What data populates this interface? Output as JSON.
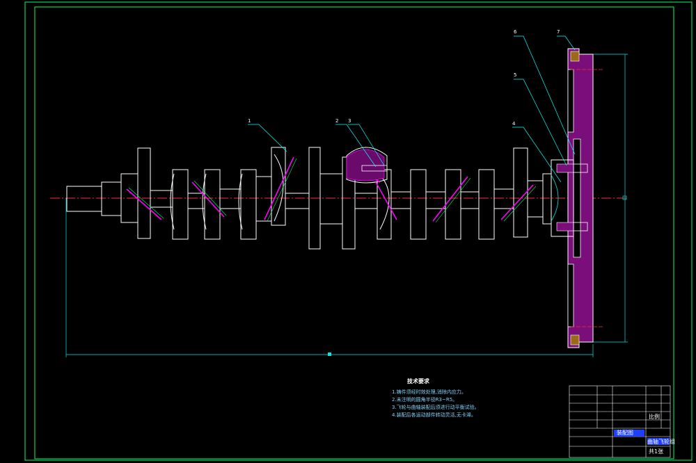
{
  "drawing": {
    "colors": {
      "background": "#000000",
      "frame": "#00ff66",
      "outline": "#ffffff",
      "dimension": "#00e5e5",
      "centerline": "#ff3030",
      "hatch": "#ff00ff",
      "leader": "#00ffff"
    },
    "callouts": [
      "1",
      "2",
      "3",
      "4",
      "5",
      "6",
      "7"
    ],
    "tech_notes": {
      "title": "技术要求",
      "lines": [
        "1.铸件须经时效处理,消除内应力。",
        "2.未注明的圆角半径R3~R5。",
        "3.飞轮与曲轴装配后须进行动平衡试验。",
        "4.装配后各运动部件转动灵活,无卡滞。"
      ]
    },
    "title_block": {
      "drawing_name": "曲轴飞轮组",
      "school": "装配图",
      "scale_label": "比例",
      "sheet_label": "共1张"
    }
  }
}
